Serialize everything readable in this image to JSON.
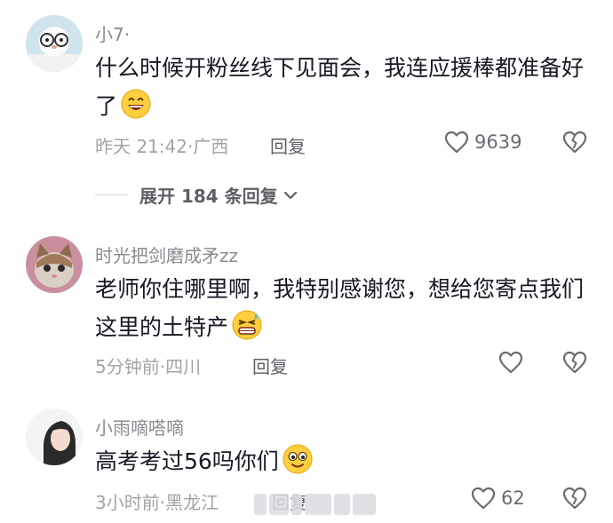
{
  "comments": [
    {
      "username": "小7·",
      "content": "什么时候开粉丝线下见面会，我连应援棒都准备好了",
      "emoji": "grinning-face-emoji",
      "time": "昨天 21:42",
      "location": "广西",
      "reply": "回复",
      "likes": "9639"
    },
    {
      "username": "时光把剑磨成矛zz",
      "content": "老师你住哪里啊，我特别感谢您，想给您寄点我们这里的土特产",
      "emoji": "grimacing-sweat-emoji",
      "time": "5分钟前",
      "location": "四川",
      "reply": "回复",
      "likes": ""
    },
    {
      "username": "小雨嘀嗒嘀",
      "content": "高考考过56吗你们",
      "emoji": "smiling-face-emoji",
      "time": "3小时前",
      "location": "黑龙江",
      "reply": "回复",
      "likes": "62"
    }
  ],
  "expand": {
    "label": "展开 184 条回复"
  },
  "meta_separator": "·",
  "colors": {
    "text": "#161823",
    "muted": "#a2a3a8",
    "username": "#8a8b91",
    "icon": "#6b6c72"
  }
}
